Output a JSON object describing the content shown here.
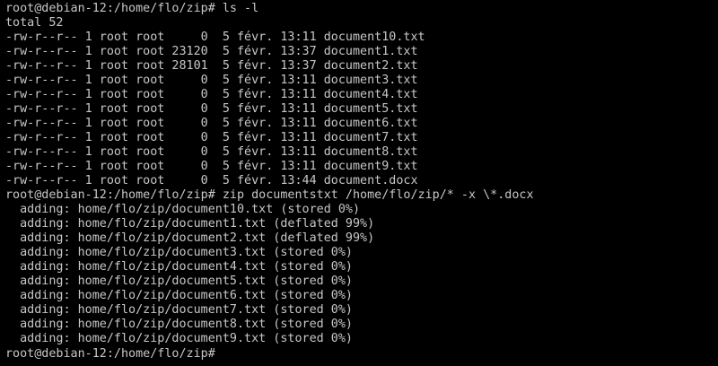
{
  "terminal": {
    "colors": {
      "background": "#000000",
      "foreground": "#c7c7c7"
    },
    "prompt": "root@debian-12:/home/flo/zip# ",
    "commands": {
      "ls": "ls -l",
      "zip": "zip documentstxt /home/flo/zip/* -x \\*.docx",
      "current": ""
    },
    "ls_total": "total 52",
    "ls_rows": [
      "-rw-r--r-- 1 root root     0  5 févr. 13:11 document10.txt",
      "-rw-r--r-- 1 root root 23120  5 févr. 13:37 document1.txt",
      "-rw-r--r-- 1 root root 28101  5 févr. 13:37 document2.txt",
      "-rw-r--r-- 1 root root     0  5 févr. 13:11 document3.txt",
      "-rw-r--r-- 1 root root     0  5 févr. 13:11 document4.txt",
      "-rw-r--r-- 1 root root     0  5 févr. 13:11 document5.txt",
      "-rw-r--r-- 1 root root     0  5 févr. 13:11 document6.txt",
      "-rw-r--r-- 1 root root     0  5 févr. 13:11 document7.txt",
      "-rw-r--r-- 1 root root     0  5 févr. 13:11 document8.txt",
      "-rw-r--r-- 1 root root     0  5 févr. 13:11 document9.txt",
      "-rw-r--r-- 1 root root     0  5 févr. 13:44 document.docx"
    ],
    "zip_rows": [
      "  adding: home/flo/zip/document10.txt (stored 0%)",
      "  adding: home/flo/zip/document1.txt (deflated 99%)",
      "  adding: home/flo/zip/document2.txt (deflated 99%)",
      "  adding: home/flo/zip/document3.txt (stored 0%)",
      "  adding: home/flo/zip/document4.txt (stored 0%)",
      "  adding: home/flo/zip/document5.txt (stored 0%)",
      "  adding: home/flo/zip/document6.txt (stored 0%)",
      "  adding: home/flo/zip/document7.txt (stored 0%)",
      "  adding: home/flo/zip/document8.txt (stored 0%)",
      "  adding: home/flo/zip/document9.txt (stored 0%)"
    ]
  }
}
